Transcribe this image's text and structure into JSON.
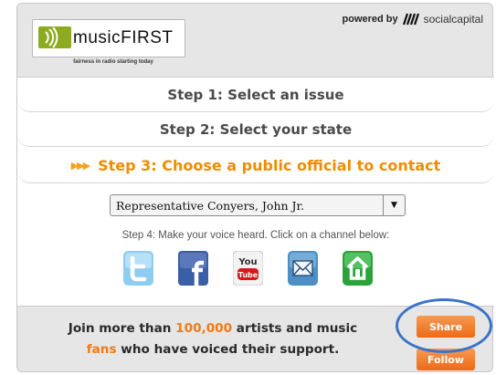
{
  "header": {
    "logo_prefix": "music",
    "logo_suffix": "FIRST",
    "tagline": "fairness in radio starting today",
    "powered_by": "powered by",
    "partner": "socialcapital"
  },
  "steps": {
    "step1": "Step 1: Select an issue",
    "step2": "Step 2: Select your state",
    "step3_arrows": "▶▶▶",
    "step3": "Step 3: Choose a public official to contact",
    "step4": "Step 4: Make your voice heard. Click on a channel below:"
  },
  "official_select": {
    "value": "Representative Conyers, John Jr.",
    "arrow": "▼"
  },
  "channels": [
    {
      "icon": "twitter-icon"
    },
    {
      "icon": "facebook-icon"
    },
    {
      "icon": "youtube-icon"
    },
    {
      "icon": "email-icon"
    },
    {
      "icon": "home-icon"
    }
  ],
  "footer": {
    "join_prefix": "Join more than ",
    "count": "100,000",
    "middle": " artists and music",
    "fans": "fans",
    "suffix": " who have voiced their support."
  },
  "buttons": {
    "share": "Share",
    "follow": "Follow"
  },
  "colors": {
    "accent_orange": "#f08c00",
    "button_orange": "#ec6a17",
    "annotation_blue": "#3a73c8",
    "panel_gray": "#e6e6e6"
  }
}
